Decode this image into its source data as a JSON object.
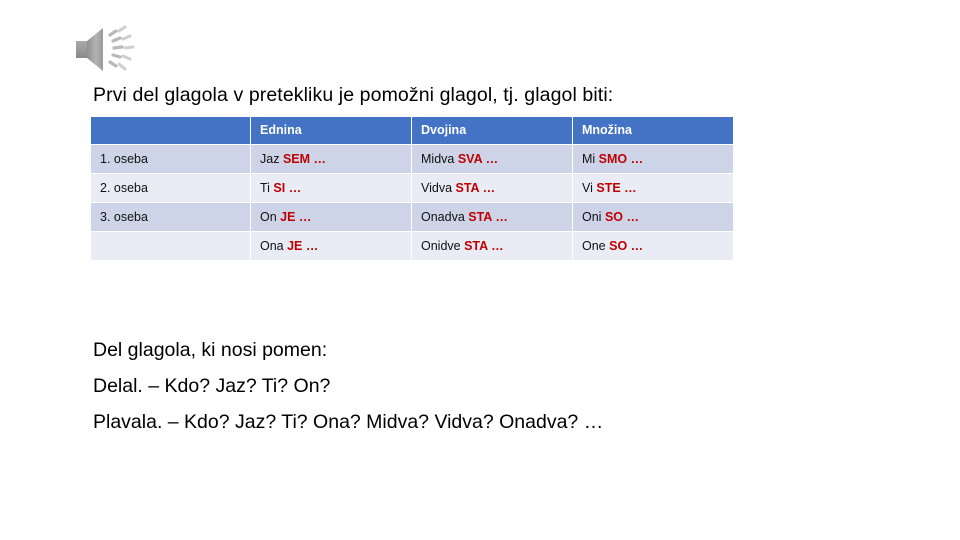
{
  "slide": {
    "audio_icon": "speaker-icon",
    "headline": "Prvi del glagola v pretekliku je pomožni glagol, tj. glagol biti:",
    "accent_colors": {
      "table_header_blue": "#4472C4",
      "row_band_dark": "#CDD4E8",
      "row_band_light": "#E9ECF5",
      "verb_red": "#C00000",
      "text_black": "#000000"
    }
  },
  "table": {
    "headers": [
      "",
      "Ednina",
      "Dvojina",
      "Množina"
    ],
    "rows": [
      {
        "person": "1. oseba",
        "ednina": {
          "pronoun": "Jaz ",
          "verb": "SEM",
          "dots": " …"
        },
        "dvojina": {
          "pronoun": "Midva ",
          "verb": "SVA",
          "dots": " …"
        },
        "mnozina": {
          "pronoun": "Mi ",
          "verb": "SMO",
          "dots": " …"
        }
      },
      {
        "person": "2. oseba",
        "ednina": {
          "pronoun": "Ti ",
          "verb": "SI",
          "dots": " …"
        },
        "dvojina": {
          "pronoun": "Vidva ",
          "verb": "STA",
          "dots": " …"
        },
        "mnozina": {
          "pronoun": "Vi ",
          "verb": "STE",
          "dots": " …"
        }
      },
      {
        "person": "3. oseba",
        "ednina": {
          "pronoun": "On ",
          "verb": "JE",
          "dots": " …"
        },
        "dvojina": {
          "pronoun": "Onadva ",
          "verb": "STA",
          "dots": " …"
        },
        "mnozina": {
          "pronoun": "Oni ",
          "verb": "SO",
          "dots": " …"
        }
      },
      {
        "person": "",
        "ednina": {
          "pronoun": "Ona ",
          "verb": "JE",
          "dots": " …"
        },
        "dvojina": {
          "pronoun": "Onidve ",
          "verb": "STA",
          "dots": " …"
        },
        "mnozina": {
          "pronoun": "One ",
          "verb": "SO",
          "dots": " …"
        }
      }
    ]
  },
  "bottom": {
    "lines": [
      "Del glagola, ki nosi pomen:",
      "Delal. – Kdo? Jaz? Ti? On?",
      "Plavala. – Kdo? Jaz? Ti? Ona? Midva? Vidva? Onadva? …"
    ]
  }
}
